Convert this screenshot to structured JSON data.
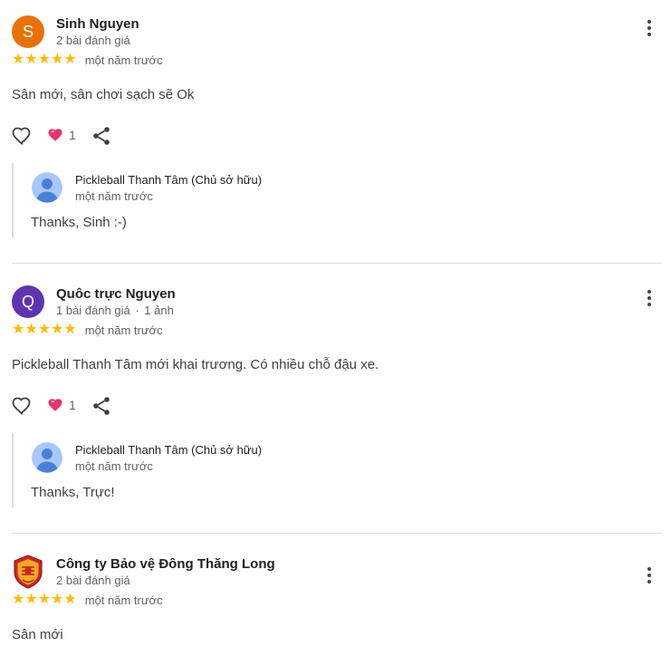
{
  "colors": {
    "star": "#fbbc04",
    "avatar_s": "#e8710a",
    "avatar_q": "#5e35b1",
    "heart_reaction": "#e8336f"
  },
  "reviews": [
    {
      "avatar_letter": "S",
      "name": "Sinh Nguyen",
      "meta": "2 bài đánh giá",
      "meta_extra": "",
      "stars": "★★★★★",
      "time": "một năm trước",
      "text": "Sân mới, sân chơi sạch sẽ Ok",
      "reaction_count": "1",
      "reply": {
        "owner": "Pickleball Thanh Tâm (Chủ sở hữu)",
        "time": "một năm trước",
        "text": "Thanks, Sinh :-)"
      }
    },
    {
      "avatar_letter": "Q",
      "name": "Quôc trực Nguyen",
      "meta": "1 bài đánh giá",
      "meta_extra": "1 ảnh",
      "stars": "★★★★★",
      "time": "một năm trước",
      "text": "Pickleball Thanh Tâm mới khai trương. Có nhiều chỗ đậu xe.",
      "reaction_count": "1",
      "reply": {
        "owner": "Pickleball Thanh Tâm (Chủ sở hữu)",
        "time": "một năm trước",
        "text": "Thanks, Trực!"
      }
    },
    {
      "avatar_letter": "",
      "name": "Công ty Bảo vệ Đông Thăng Long",
      "meta": "2 bài đánh giá",
      "meta_extra": "",
      "stars": "★★★★★",
      "time": "một năm trước",
      "text": "Sân mới"
    }
  ],
  "meta_separator": "·",
  "icons": {
    "more": "more-vert-icon",
    "like": "heart-outline-icon",
    "reaction": "heart-reaction-icon",
    "share": "share-icon",
    "owner_avatar": "default-person-icon",
    "company_logo": "shield-logo-icon"
  }
}
